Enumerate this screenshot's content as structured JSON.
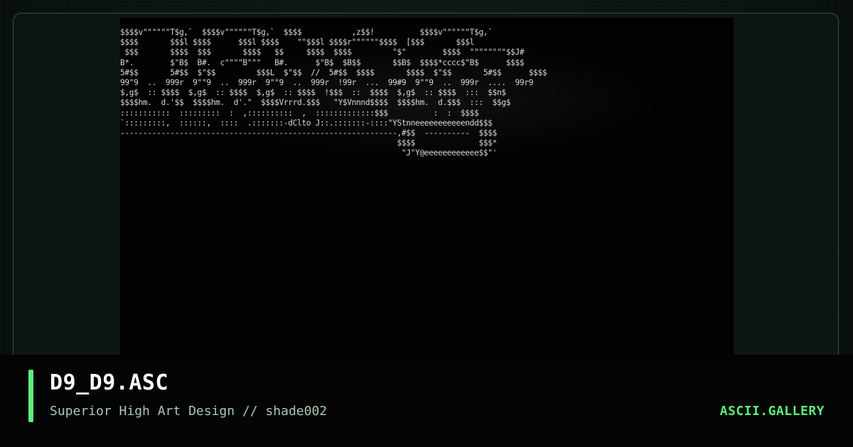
{
  "colors": {
    "accent": "#5cf07a",
    "brand": "#5cf07a",
    "subtitle": "#a9c9b2",
    "title": "#ffffff",
    "art_foreground": "#d6d6d6",
    "art_background": "#020202"
  },
  "artwork": {
    "text": "$$$$v\"\"\"\"\"\"T$g,`  $$$$v\"\"\"\"\"\"T$g,`  $$$$           ,z$$!          $$$$v\"\"\"\"\"\"T$g,`\n$$$$       $$$l $$$$      $$$l $$$$    \"\"$$$l $$$$r\"\"\"\"\"\"$$$$  [$$$       $$$l\n $$$       $$$$  $$$       $$$$   $$     $$$$  $$$$         \"$\"        $$$$  \"\"\"\"\"\"\"\"$$J#\nB*.        $\"B$  B#.  c\"\"\"\"B\"\"\"   B#.      $\"B$  $B$$       $$B$  $$$$*cccc$\"B$      $$$$\n5#$$       5#$$  $\"$$         $$$L  $\"$$  //  5#$$  $$$$       $$$$  $\"$$       5#$$      $$$$\n99\"9  ..  999r  9\"\"9  ..  999r  9\"\"9  ..  999r  !99r  ...  99#9  9\"\"9  ..  999r  ....  99r9\n$,g$  :: $$$$  $,g$  :: $$$$  $,g$  :: $$$$  !$$$  ::  $$$$  $,g$  :: $$$$  :::  $$n$\n$$$$hm.  d.'$$  $$$$hm.  d'.\"  $$$$Vrrrd.$$$   \"Y$Vnnnd$$$$  $$$$hm.  d.$$$  :::  $$g$\n:::::::::::  :::::::::  :  ,::::::::::  ,  :::::::::::::$$$          :  :  $$$$\n`:::::::::,  ::::::,  ::::  .:::::::-dClto J::.:::::::-::::\"YStnneeeeeeeeeeendd$$$\n-------------------------------------------------------------,#$$  ----------  $$$$\n                                                             $$$$              $$$*\n                                                              \"J\"Y@eeeeeeeeeeee$$\"'"
  },
  "footer": {
    "title": "D9_D9.ASC",
    "subtitle": "Superior High Art Design // shade002",
    "brand": "ASCII.GALLERY"
  }
}
